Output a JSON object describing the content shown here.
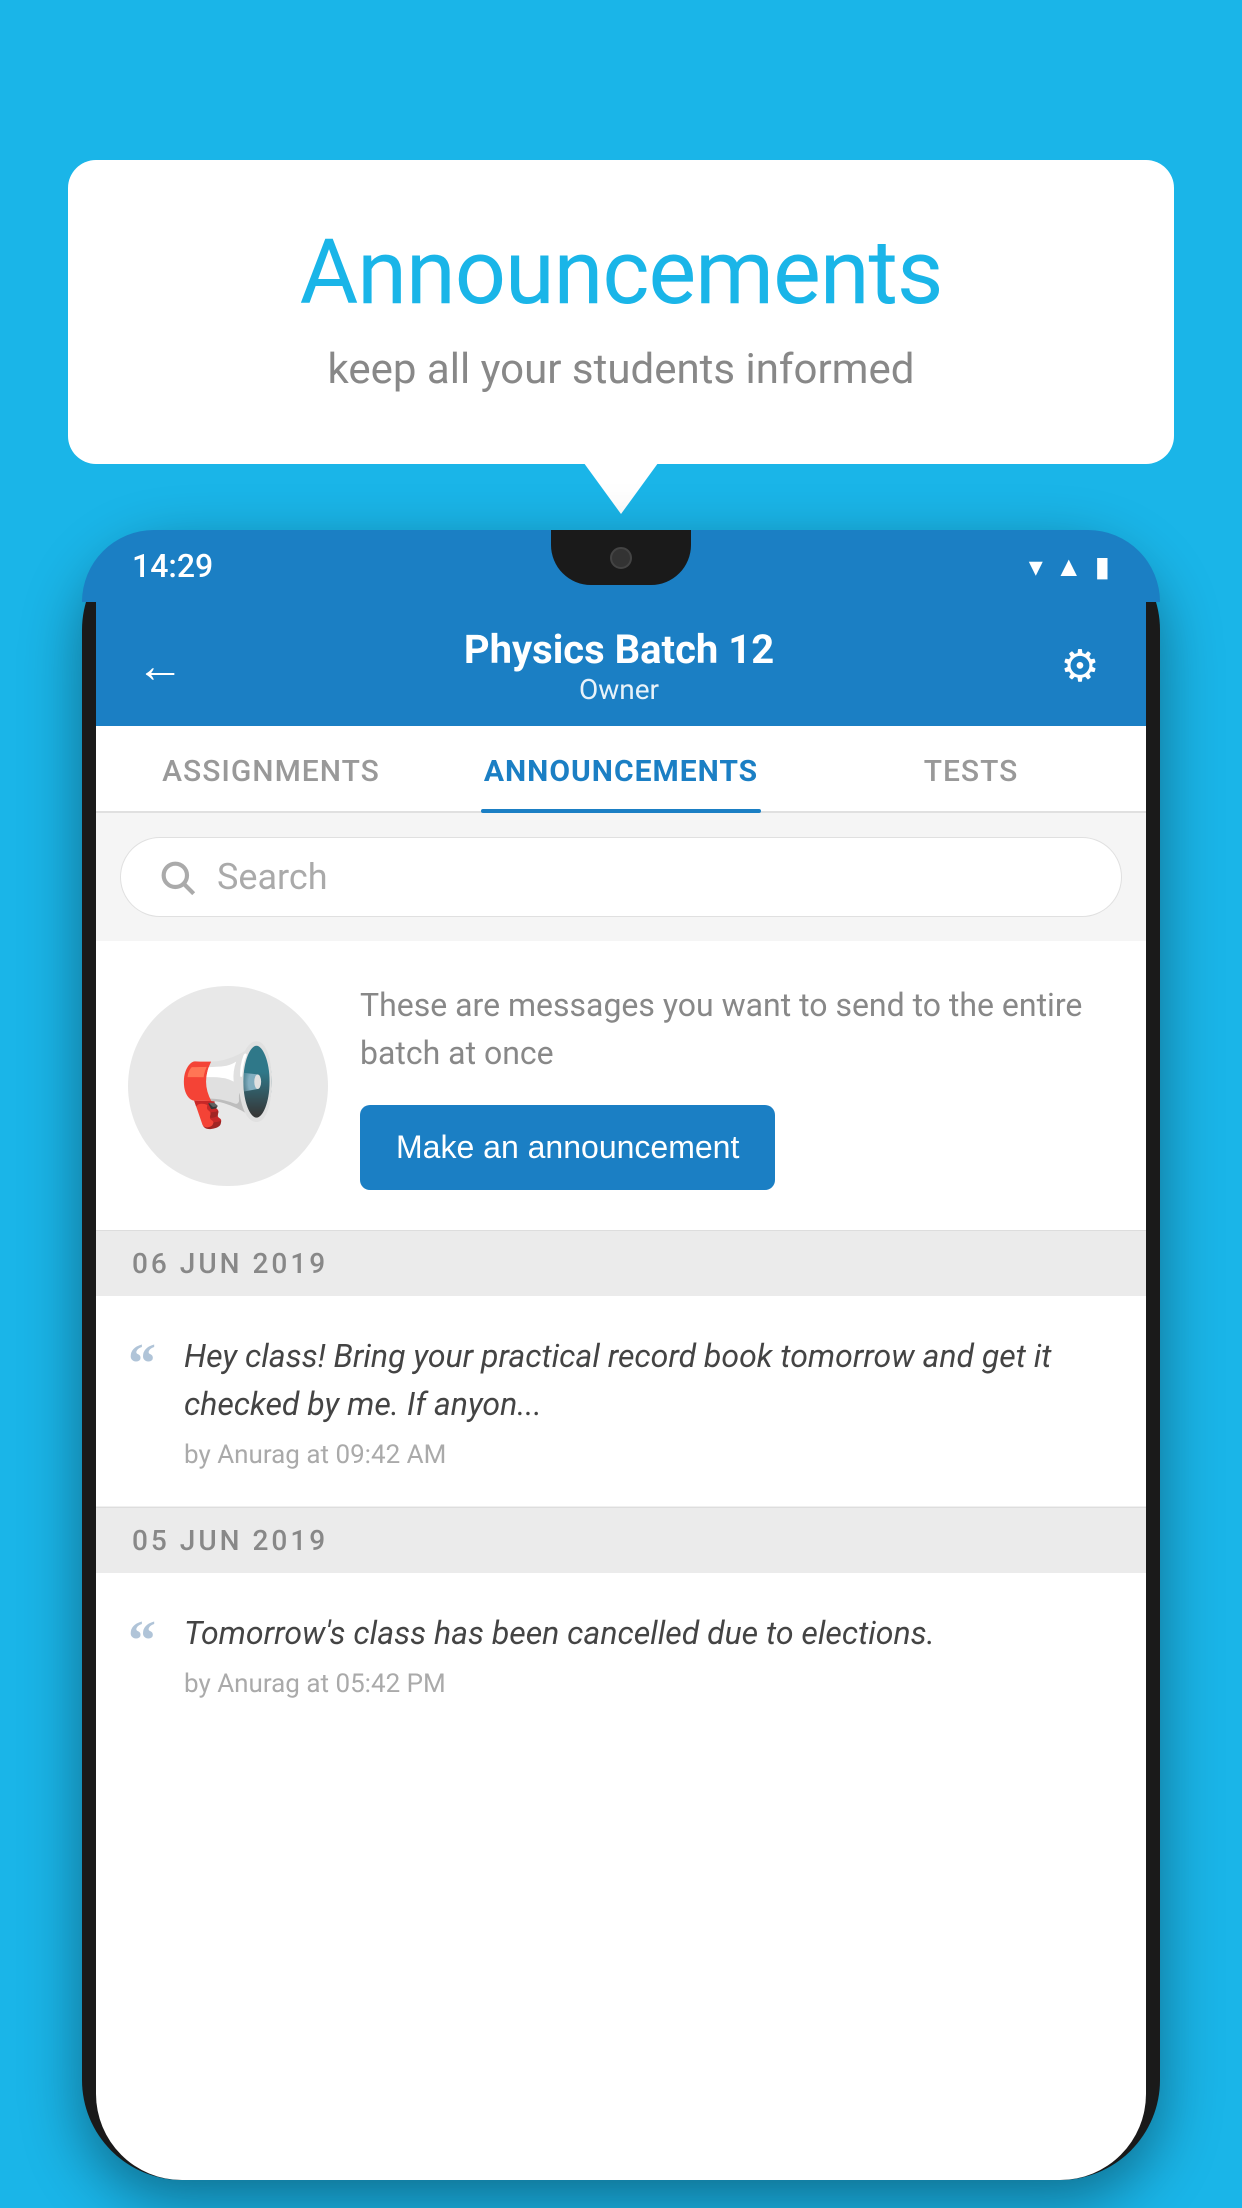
{
  "background_color": "#1ab5e8",
  "speech_bubble": {
    "title": "Announcements",
    "subtitle": "keep all your students informed"
  },
  "phone": {
    "status_bar": {
      "time": "14:29",
      "icons": [
        "wifi",
        "signal",
        "battery"
      ]
    },
    "header": {
      "title": "Physics Batch 12",
      "subtitle": "Owner",
      "back_label": "←",
      "gear_label": "⚙"
    },
    "tabs": [
      {
        "label": "ASSIGNMENTS",
        "active": false
      },
      {
        "label": "ANNOUNCEMENTS",
        "active": true
      },
      {
        "label": "TESTS",
        "active": false
      }
    ],
    "search": {
      "placeholder": "Search"
    },
    "intro": {
      "description": "These are messages you want to send to the entire batch at once",
      "button_label": "Make an announcement"
    },
    "announcements": [
      {
        "date": "06  JUN  2019",
        "message": "Hey class! Bring your practical record book tomorrow and get it checked by me. If anyon...",
        "meta": "by Anurag at 09:42 AM"
      },
      {
        "date": "05  JUN  2019",
        "message": "Tomorrow's class has been cancelled due to elections.",
        "meta": "by Anurag at 05:42 PM"
      }
    ]
  }
}
